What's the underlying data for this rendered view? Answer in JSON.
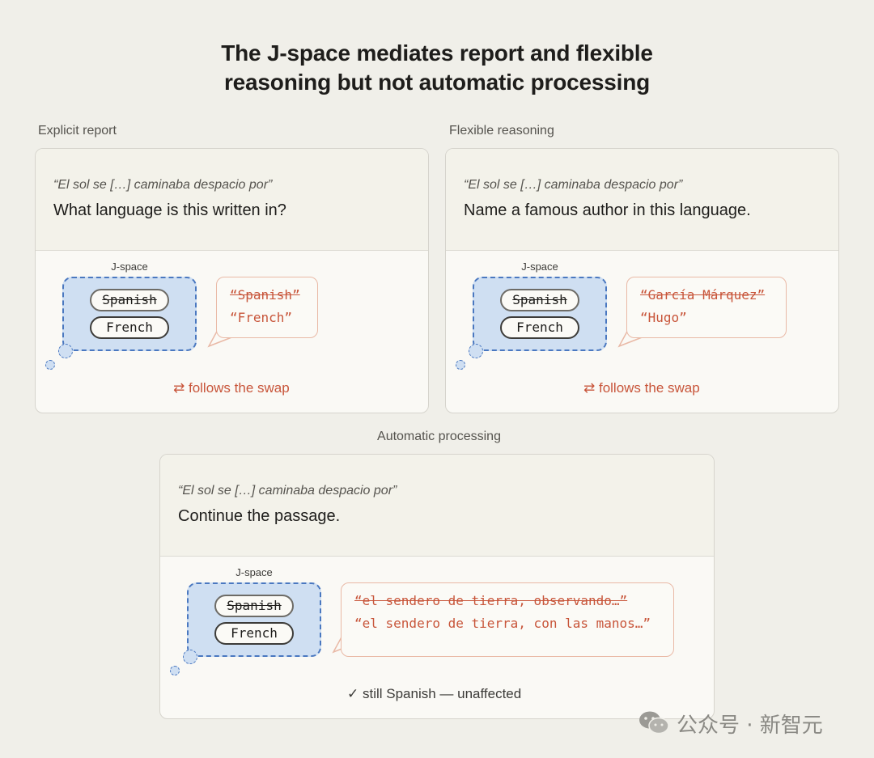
{
  "title": {
    "line1": "The J-space mediates report and flexible",
    "line2": "reasoning but not automatic processing"
  },
  "panels": [
    {
      "label": "Explicit report",
      "quote": "“El sol se […] caminaba despacio por”",
      "question": "What language is this written in?",
      "jspace_label": "J-space",
      "pill_original": "Spanish",
      "pill_swapped": "French",
      "response_original": "“Spanish”",
      "response_swapped": "“French”",
      "result": "⇄ follows the swap"
    },
    {
      "label": "Flexible reasoning",
      "quote": "“El sol se […] caminaba despacio por”",
      "question": "Name a famous author in this language.",
      "jspace_label": "J-space",
      "pill_original": "Spanish",
      "pill_swapped": "French",
      "response_original": "“García Márquez”",
      "response_swapped": "“Hugo”",
      "result": "⇄ follows the swap"
    },
    {
      "label": "Automatic processing",
      "quote": "“El sol se […] caminaba despacio por”",
      "question": "Continue the passage.",
      "jspace_label": "J-space",
      "pill_original": "Spanish",
      "pill_swapped": "French",
      "response_original": "“el sendero de tierra, observando…”",
      "response_swapped": "“el sendero de tierra, con las manos…”",
      "result": "✓ still Spanish — unaffected"
    }
  ],
  "watermark": "公众号 · 新智元",
  "colors": {
    "background": "#f0efe9",
    "accent": "#c8553a",
    "jspace_fill": "#cfdff2",
    "jspace_border": "#4a78c0"
  }
}
